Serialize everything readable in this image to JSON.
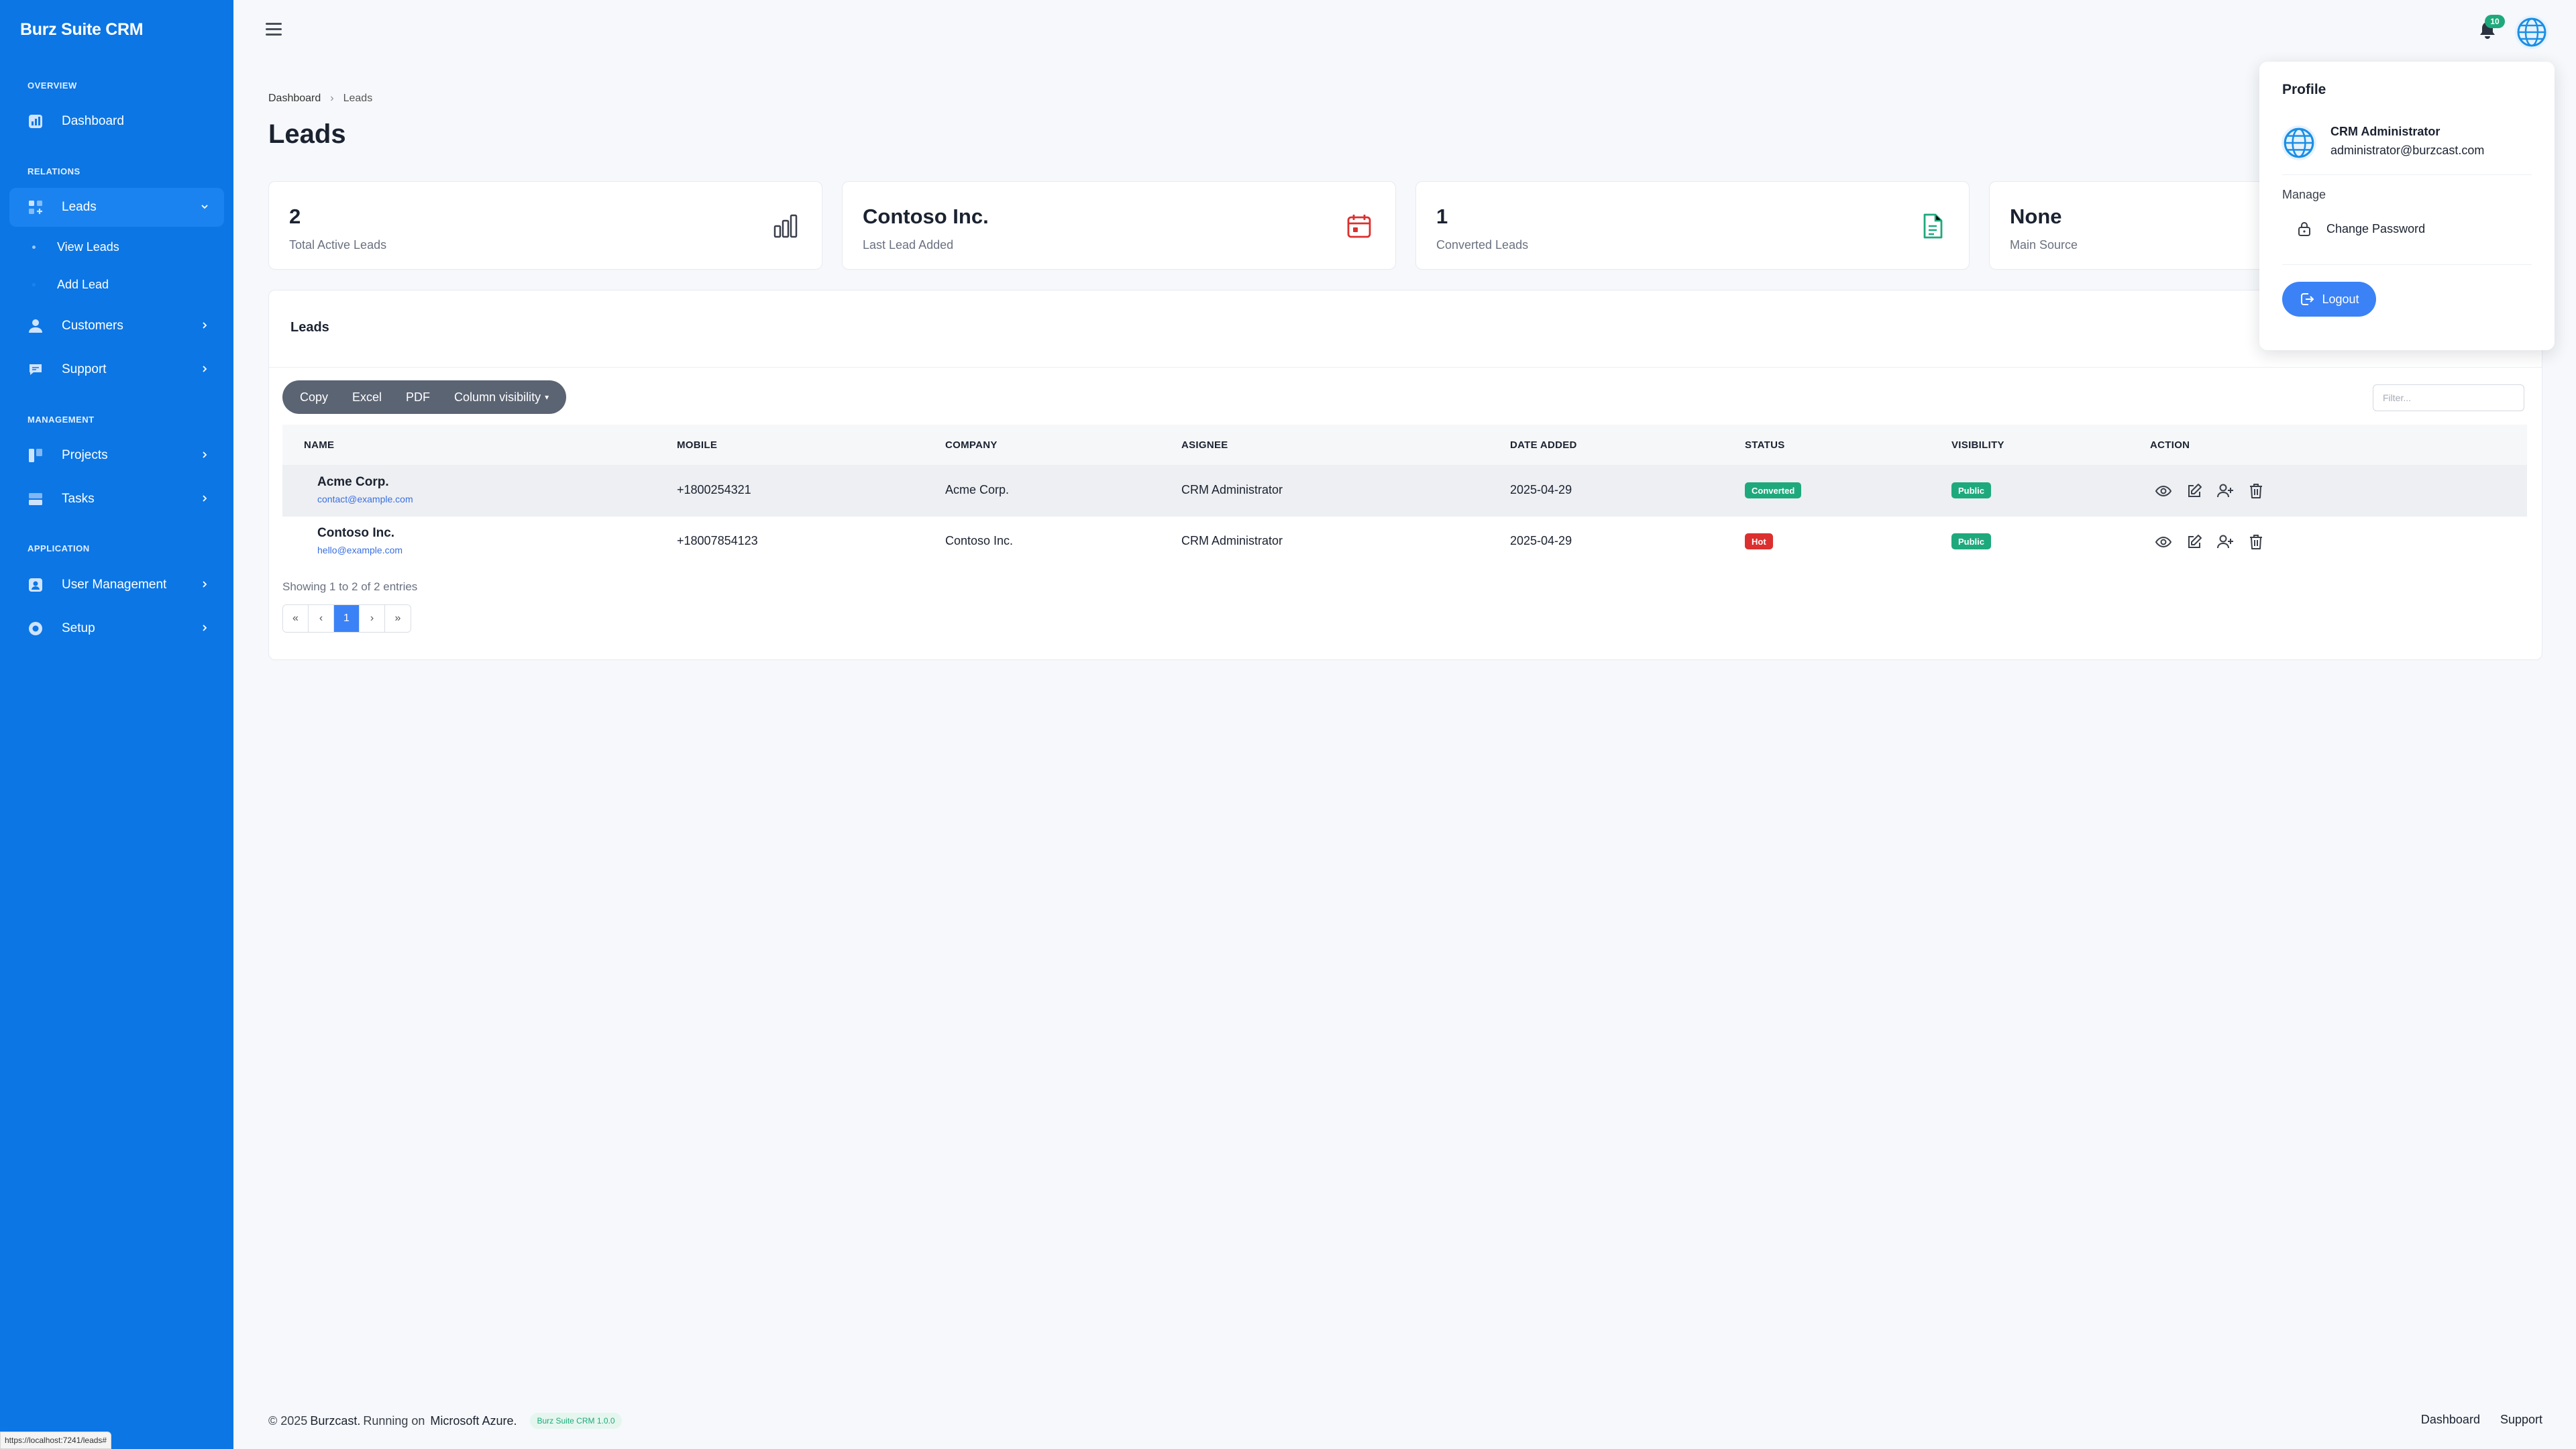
{
  "app": {
    "brand": "Burz Suite CRM"
  },
  "sidebar": {
    "sections": {
      "overview": "OVERVIEW",
      "relations": "RELATIONS",
      "management": "MANAGEMENT",
      "application": "APPLICATION"
    },
    "items": {
      "dashboard": "Dashboard",
      "leads": "Leads",
      "view_leads": "View Leads",
      "add_lead": "Add Lead",
      "customers": "Customers",
      "support": "Support",
      "projects": "Projects",
      "tasks": "Tasks",
      "user_management": "User Management",
      "setup": "Setup"
    }
  },
  "status_url": "https://localhost:7241/leads#",
  "header": {
    "notification_count": "10"
  },
  "breadcrumb": {
    "home": "Dashboard",
    "current": "Leads"
  },
  "page_title": "Leads",
  "stats": [
    {
      "value": "2",
      "label": "Total Active Leads",
      "icon": "bar-chart-icon",
      "color": "#3a3f4a"
    },
    {
      "value": "Contoso Inc.",
      "label": "Last Lead Added",
      "icon": "calendar-icon",
      "color": "#dc2f2f"
    },
    {
      "value": "1",
      "label": "Converted Leads",
      "icon": "document-icon",
      "color": "#1ea97c"
    },
    {
      "value": "None",
      "label": "Main Source",
      "icon": "source-icon"
    }
  ],
  "panel": {
    "title": "Leads",
    "buttons": {
      "copy": "Copy",
      "excel": "Excel",
      "pdf": "PDF",
      "colvis": "Column visibility"
    },
    "filter_placeholder": "Filter..."
  },
  "table": {
    "columns": [
      "NAME",
      "MOBILE",
      "COMPANY",
      "ASIGNEE",
      "DATE ADDED",
      "STATUS",
      "VISIBILITY",
      "ACTION"
    ],
    "rows": [
      {
        "name": "Acme Corp.",
        "email": "contact@example.com",
        "mobile": "+1800254321",
        "company": "Acme Corp.",
        "assignee": "CRM Administrator",
        "date": "2025-04-29",
        "status": "Converted",
        "visibility": "Public"
      },
      {
        "name": "Contoso Inc.",
        "email": "hello@example.com",
        "mobile": "+18007854123",
        "company": "Contoso Inc.",
        "assignee": "CRM Administrator",
        "date": "2025-04-29",
        "status": "Hot",
        "visibility": "Public"
      }
    ],
    "entries_text": "Showing 1 to 2 of 2 entries",
    "pager": [
      "«",
      "‹",
      "1",
      "›",
      "»"
    ]
  },
  "profile": {
    "title": "Profile",
    "name": "CRM Administrator",
    "email": "administrator@burzcast.com",
    "manage_label": "Manage",
    "change_password": "Change Password",
    "logout": "Logout"
  },
  "footer": {
    "copyright": "© 2025",
    "company": "Burzcast.",
    "running_on": "Running on",
    "platform": "Microsoft Azure.",
    "version": "Burz Suite CRM 1.0.0",
    "links": {
      "dashboard": "Dashboard",
      "support": "Support"
    }
  },
  "colors": {
    "sidebar": "#0c76e4",
    "accent": "#3b82f6",
    "success": "#1ea97c",
    "danger": "#dc2f2f"
  }
}
